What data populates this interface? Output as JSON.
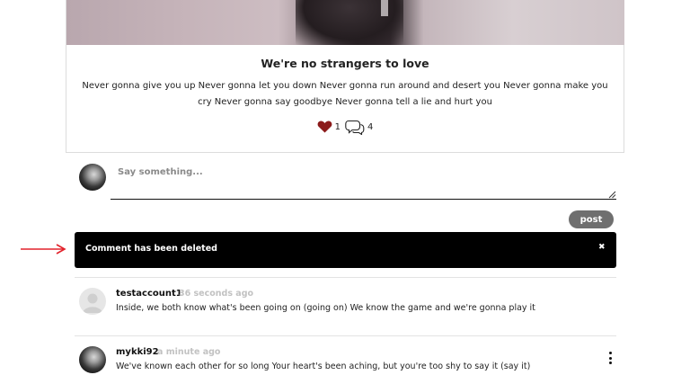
{
  "post": {
    "title": "We're no strangers to love",
    "body": "Never gonna give you up Never gonna let you down Never gonna run around and desert you Never gonna make you cry Never gonna say goodbye Never gonna tell a lie and hurt you",
    "likes": "1",
    "comments_count": "4"
  },
  "composer": {
    "placeholder": "Say something...",
    "post_label": "post"
  },
  "alert": {
    "message": "Comment has been deleted",
    "close_glyph": "✖"
  },
  "comments": [
    {
      "user": "testaccount1",
      "time": "36 seconds ago",
      "text": "Inside, we both know what's been going on (going on) We know the game and we're gonna play it"
    },
    {
      "user": "mykki92",
      "time": "a minute ago",
      "text": "We've known each other for so long Your heart's been aching, but you're too shy to say it (say it)"
    }
  ],
  "icons": {
    "heart": "heart-icon",
    "comment": "comment-bubble-icon",
    "arrow": "arrow-right-icon",
    "menu": "more-vertical-icon"
  },
  "colors": {
    "heart": "#8b1a1a",
    "arrow": "#e2222b",
    "alert_bg": "#000000",
    "post_button": "#6f6f6f",
    "timestamp": "#c2c2c2"
  }
}
